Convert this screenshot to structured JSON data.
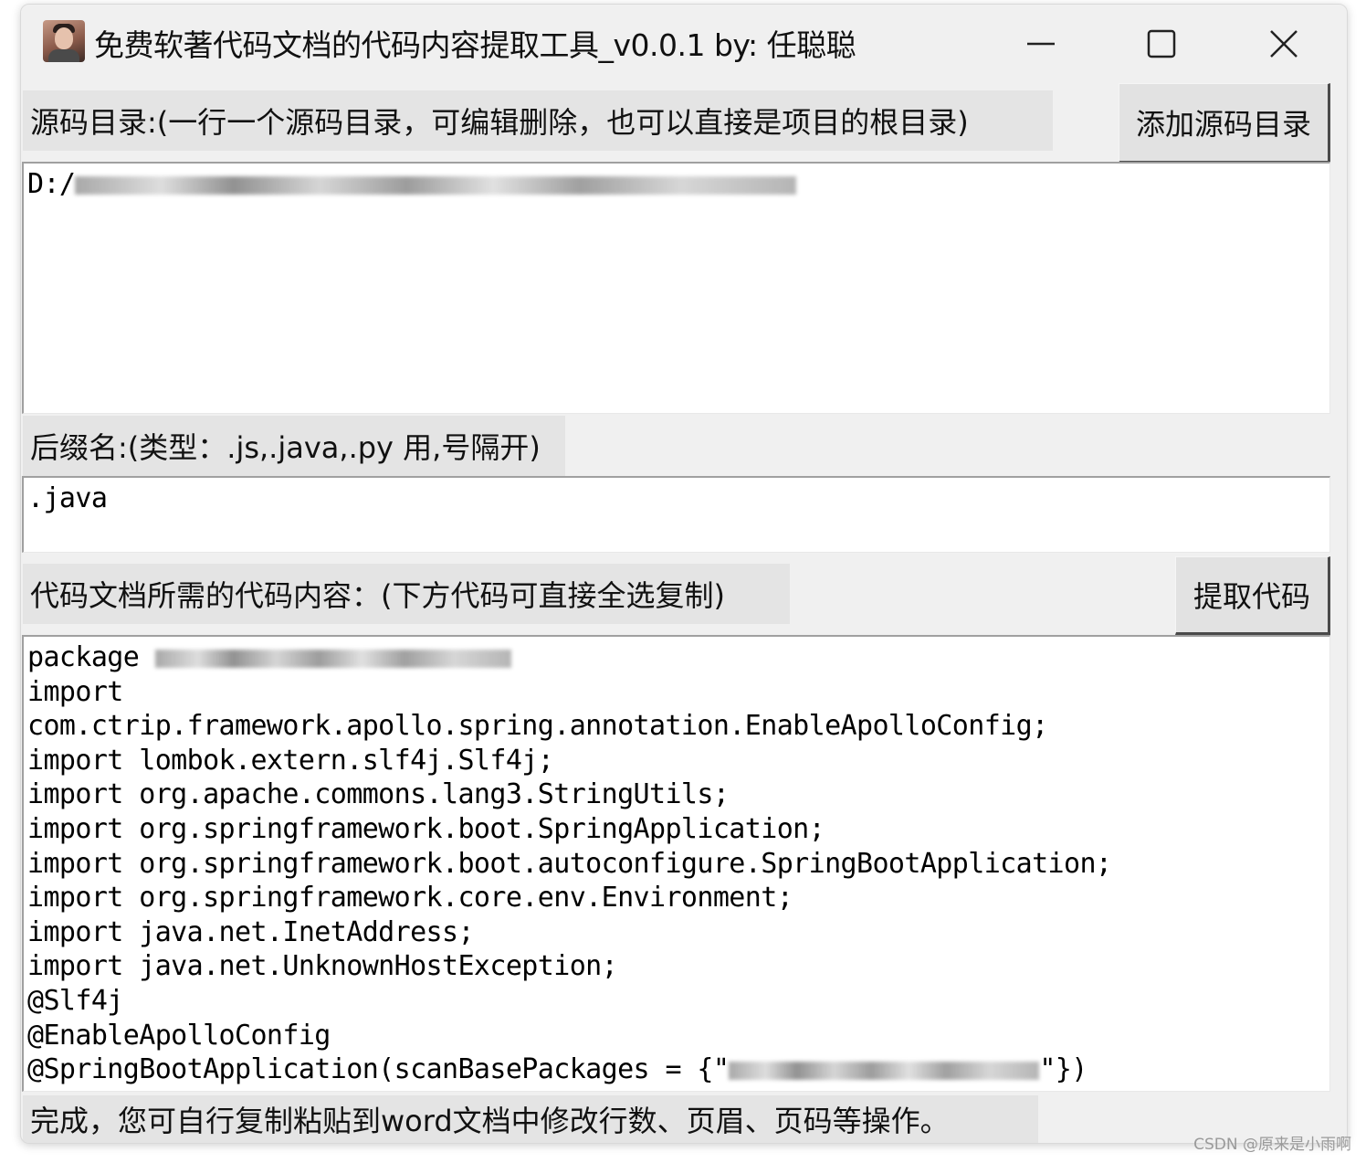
{
  "window": {
    "title": "免费软著代码文档的代码内容提取工具_v0.0.1    by: 任聪聪",
    "minimize_icon": "minimize-icon",
    "maximize_icon": "maximize-icon",
    "close_icon": "close-icon"
  },
  "source_dirs": {
    "label": "源码目录:(一行一个源码目录，可编辑删除，也可以直接是项目的根目录)",
    "add_button": "添加源码目录",
    "value_prefix": "D:/"
  },
  "suffix": {
    "label": "后缀名:(类型：.js,.java,.py 用,号隔开)",
    "value": ".java"
  },
  "output": {
    "label": "代码文档所需的代码内容：(下方代码可直接全选复制)",
    "extract_button": "提取代码",
    "lines": {
      "l0": "package ",
      "l1": "import",
      "l2": "com.ctrip.framework.apollo.spring.annotation.EnableApolloConfig;",
      "l3": "import lombok.extern.slf4j.Slf4j;",
      "l4": "import org.apache.commons.lang3.StringUtils;",
      "l5": "import org.springframework.boot.SpringApplication;",
      "l6": "import org.springframework.boot.autoconfigure.SpringBootApplication;",
      "l7": "import org.springframework.core.env.Environment;",
      "l8": "import java.net.InetAddress;",
      "l9": "import java.net.UnknownHostException;",
      "l10": "@Slf4j",
      "l11": "@EnableApolloConfig",
      "l12a": "@SpringBootApplication(scanBasePackages = {\"",
      "l12b": "\"})"
    }
  },
  "status": {
    "text": "完成，您可自行复制粘贴到word文档中修改行数、页眉、页码等操作。"
  },
  "watermark": "CSDN @原来是小雨啊"
}
